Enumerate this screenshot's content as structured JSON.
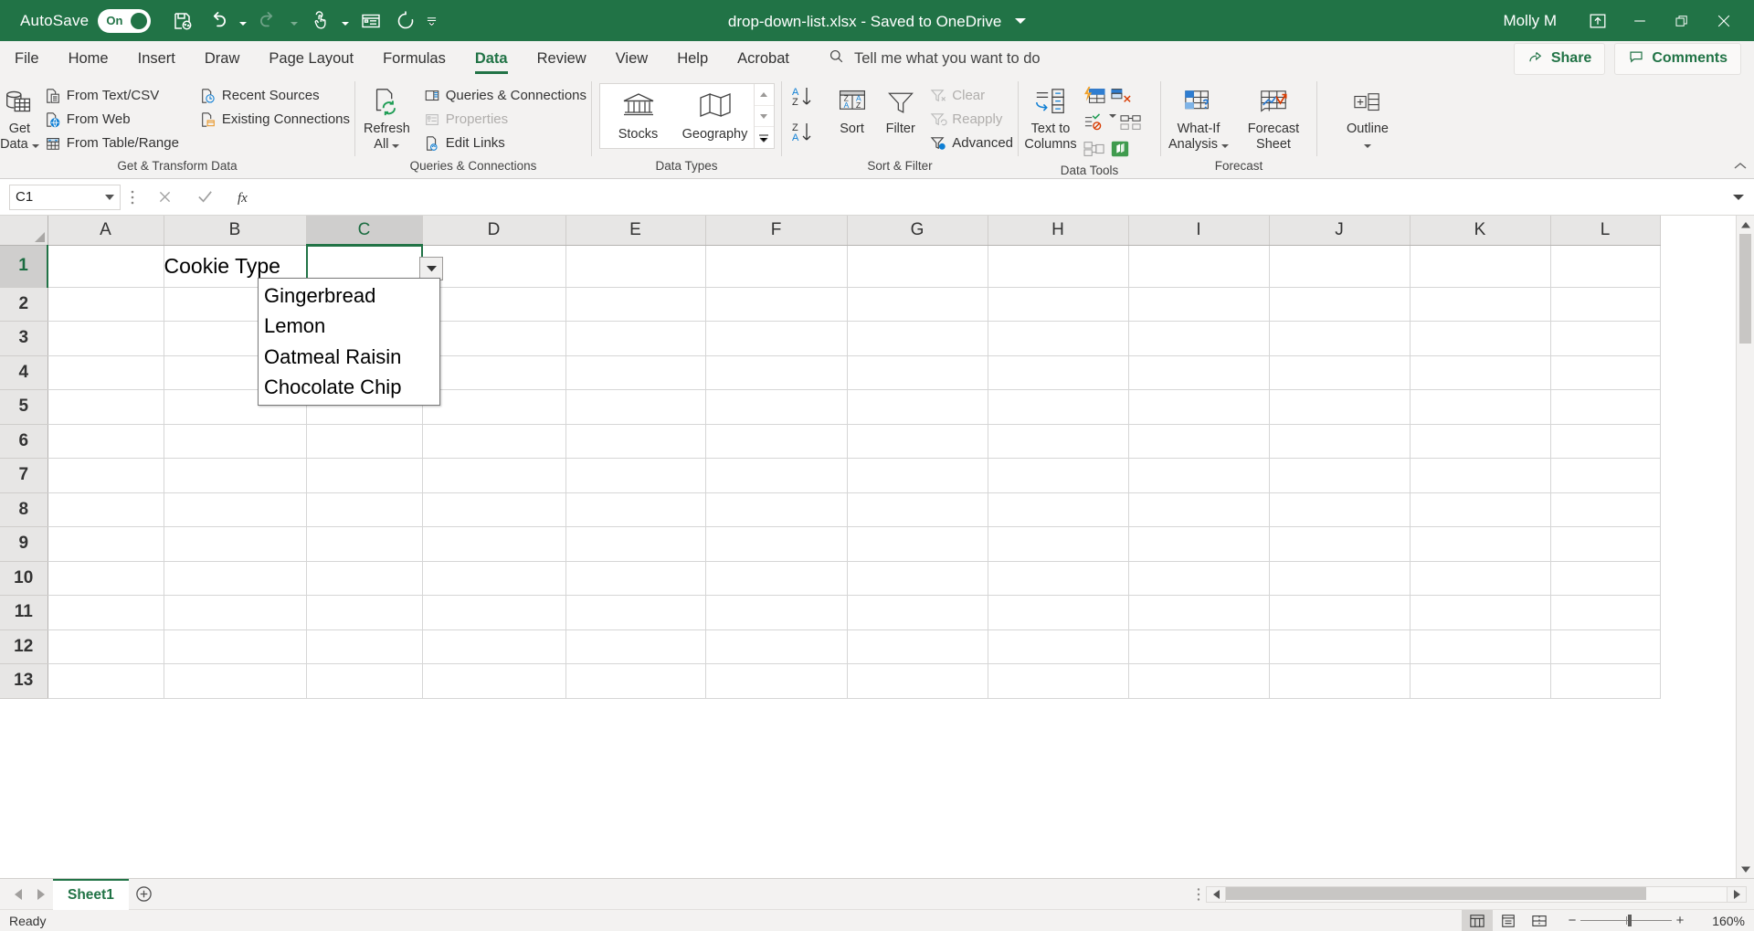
{
  "titlebar": {
    "autosave_label": "AutoSave",
    "autosave_state": "On",
    "document_title": "drop-down-list.xlsx  -  Saved to OneDrive",
    "user_name": "Molly M",
    "qat": [
      {
        "name": "save-icon",
        "label": "Save"
      },
      {
        "name": "undo-icon",
        "label": "Undo"
      },
      {
        "name": "redo-icon",
        "label": "Redo"
      },
      {
        "name": "touch-mode-icon",
        "label": "Touch/Mouse Mode"
      },
      {
        "name": "form-icon",
        "label": "Form"
      },
      {
        "name": "refresh-icon",
        "label": "Refresh"
      },
      {
        "name": "customize-qat-icon",
        "label": "Customize Quick Access Toolbar"
      }
    ],
    "window_buttons": [
      {
        "name": "ribbon-display-options-icon",
        "label": "Ribbon Display Options"
      },
      {
        "name": "minimize-icon",
        "label": "Minimize"
      },
      {
        "name": "restore-icon",
        "label": "Restore Down"
      },
      {
        "name": "close-icon",
        "label": "Close"
      }
    ]
  },
  "tabs": [
    {
      "label": "File",
      "active": false
    },
    {
      "label": "Home",
      "active": false
    },
    {
      "label": "Insert",
      "active": false
    },
    {
      "label": "Draw",
      "active": false
    },
    {
      "label": "Page Layout",
      "active": false
    },
    {
      "label": "Formulas",
      "active": false
    },
    {
      "label": "Data",
      "active": true
    },
    {
      "label": "Review",
      "active": false
    },
    {
      "label": "View",
      "active": false
    },
    {
      "label": "Help",
      "active": false
    },
    {
      "label": "Acrobat",
      "active": false
    }
  ],
  "search": {
    "placeholder": "Tell me what you want to do"
  },
  "share": {
    "share_label": "Share",
    "comments_label": "Comments"
  },
  "ribbon": {
    "groups": [
      {
        "caption": "Get & Transform Data",
        "big": {
          "label_line1": "Get",
          "label_line2": "Data"
        },
        "col1": [
          {
            "label": "From Text/CSV",
            "disabled": false
          },
          {
            "label": "From Web",
            "disabled": false
          },
          {
            "label": "From Table/Range",
            "disabled": false
          }
        ],
        "col2": [
          {
            "label": "Recent Sources",
            "disabled": false
          },
          {
            "label": "Existing Connections",
            "disabled": false
          }
        ]
      },
      {
        "caption": "Queries & Connections",
        "big": {
          "label_line1": "Refresh",
          "label_line2": "All"
        },
        "col1": [
          {
            "label": "Queries & Connections",
            "disabled": false
          },
          {
            "label": "Properties",
            "disabled": true
          },
          {
            "label": "Edit Links",
            "disabled": false
          }
        ]
      },
      {
        "caption": "Data Types",
        "gallery": [
          {
            "label": "Stocks"
          },
          {
            "label": "Geography"
          }
        ]
      },
      {
        "caption": "Sort & Filter",
        "sort_label": "Sort",
        "filter_label": "Filter",
        "small": [
          {
            "label": "Clear",
            "disabled": true
          },
          {
            "label": "Reapply",
            "disabled": true
          },
          {
            "label": "Advanced",
            "disabled": false
          }
        ]
      },
      {
        "caption": "Data Tools",
        "text_to_columns": {
          "label_line1": "Text to",
          "label_line2": "Columns"
        }
      },
      {
        "caption": "Forecast",
        "what_if": {
          "label_line1": "What-If",
          "label_line2": "Analysis"
        },
        "forecast_sheet": {
          "label_line1": "Forecast",
          "label_line2": "Sheet"
        }
      },
      {
        "caption": "",
        "outline": {
          "label": "Outline"
        }
      }
    ]
  },
  "formula_bar": {
    "name_box_value": "C1",
    "cancel_icon": "cancel-icon",
    "enter_icon": "enter-icon",
    "function_icon": "insert-function-icon",
    "formula_value": ""
  },
  "grid": {
    "columns": [
      "A",
      "B",
      "C",
      "D",
      "E",
      "F",
      "G",
      "H",
      "I",
      "J",
      "K",
      "L"
    ],
    "selected_column": "C",
    "rows": [
      "1",
      "2",
      "3",
      "4",
      "5",
      "6",
      "7",
      "8",
      "9",
      "10",
      "11",
      "12",
      "13"
    ],
    "selected_row": "1",
    "cells": [
      {
        "ref": "B1",
        "value": "Cookie Type"
      }
    ],
    "active_cell": "C1",
    "dropdown": {
      "open": true,
      "items": [
        "Gingerbread",
        "Lemon",
        "Oatmeal Raisin",
        "Chocolate Chip"
      ]
    }
  },
  "sheetbar": {
    "tabs": [
      {
        "label": "Sheet1",
        "active": true
      }
    ],
    "add_sheet_icon": "add-sheet-icon"
  },
  "statusbar": {
    "status_text": "Ready",
    "views": [
      {
        "name": "normal-view-icon",
        "active": true
      },
      {
        "name": "page-layout-view-icon",
        "active": false
      },
      {
        "name": "page-break-preview-icon",
        "active": false
      }
    ],
    "zoom_out_label": "−",
    "zoom_in_label": "+",
    "zoom_value": "160%"
  },
  "colors": {
    "brand_green": "#217346",
    "ribbon_bg": "#f3f2f1",
    "grid_line": "#d6d6d6",
    "header_bg": "#e7e6e5"
  }
}
